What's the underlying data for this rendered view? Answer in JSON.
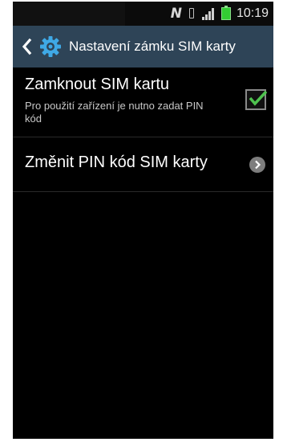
{
  "status_bar": {
    "nfc": "N",
    "time": "10:19",
    "icons": [
      "nfc-icon",
      "vibrate-icon",
      "signal-icon",
      "battery-icon"
    ]
  },
  "action_bar": {
    "title": "Nastavení zámku SIM karty",
    "back_icon": "chevron-left-icon",
    "app_icon": "gear-icon",
    "accent": "#2e4457"
  },
  "settings": {
    "lock_sim": {
      "title": "Zamknout SIM kartu",
      "summary": "Pro použití zařízení je nutno zadat PIN kód",
      "checked": true
    },
    "change_pin": {
      "title": "Změnit PIN kód SIM karty",
      "icon": "chevron-right-icon"
    }
  },
  "colors": {
    "background": "#000000",
    "checkmark": "#4fc24f"
  }
}
